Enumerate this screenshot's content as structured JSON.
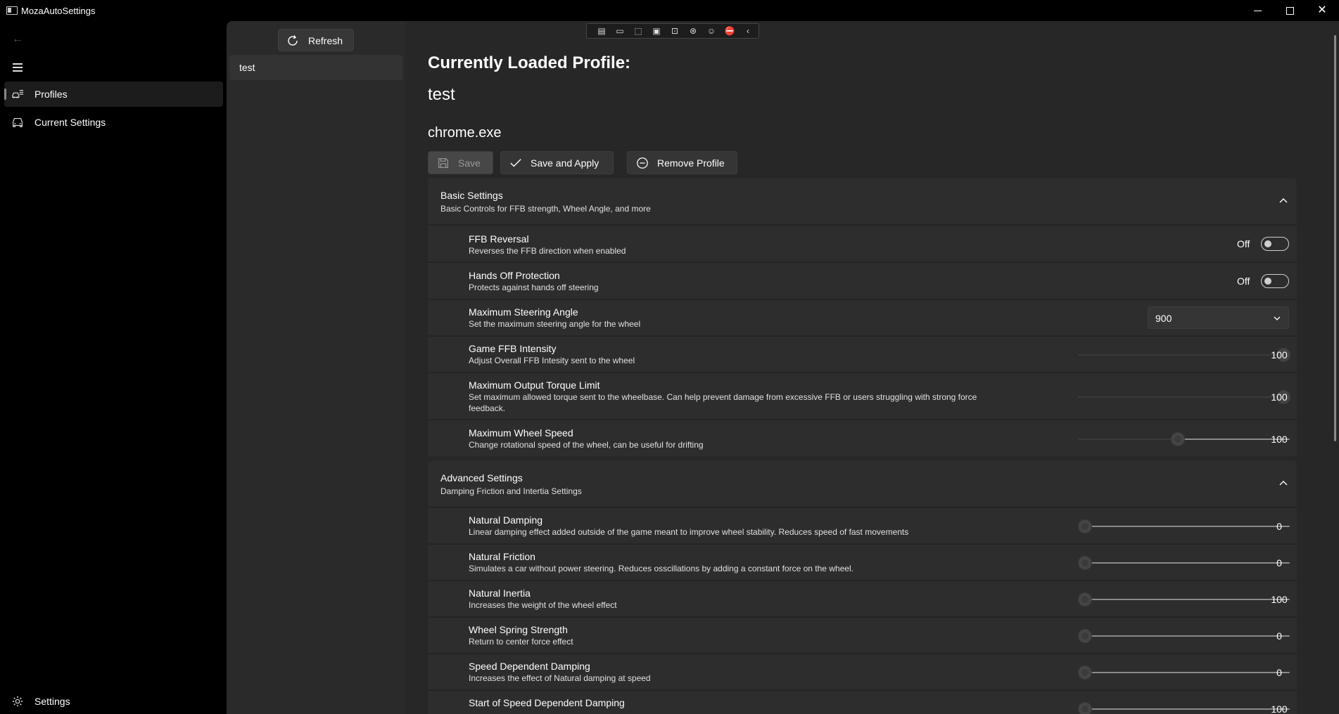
{
  "window": {
    "title": "MozaAutoSettings"
  },
  "nav": {
    "items": [
      {
        "label": "Profiles",
        "icon": "car-list-icon",
        "selected": true
      },
      {
        "label": "Current Settings",
        "icon": "car-icon",
        "selected": false
      }
    ],
    "footer": {
      "label": "Settings",
      "icon": "gear-icon"
    }
  },
  "profiles_panel": {
    "refresh_label": "Refresh",
    "items": [
      "test"
    ]
  },
  "main": {
    "heading": "Currently Loaded Profile:",
    "profile_name": "test",
    "executable": "chrome.exe",
    "buttons": {
      "save": "Save",
      "save_apply": "Save and Apply",
      "remove": "Remove Profile"
    },
    "basic": {
      "title": "Basic Settings",
      "subtitle": "Basic Controls for FFB strength, Wheel Angle, and more",
      "rows": [
        {
          "title": "FFB Reversal",
          "desc": "Reverses the FFB direction when enabled",
          "control": "toggle",
          "state": "Off"
        },
        {
          "title": "Hands Off Protection",
          "desc": "Protects against hands off steering",
          "control": "toggle",
          "state": "Off"
        },
        {
          "title": "Maximum Steering Angle",
          "desc": "Set the maximum steering angle for the wheel",
          "control": "dropdown",
          "value": "900"
        },
        {
          "title": "Game FFB Intensity",
          "desc": "Adjust Overall FFB Intesity sent to the wheel",
          "control": "slider",
          "value": "100",
          "fraction": 0.97
        },
        {
          "title": "Maximum Output Torque Limit",
          "desc": "Set maximum allowed torque sent to the wheelbase. Can help prevent damage from excessive FFB or users struggling with strong force feedback.",
          "control": "slider",
          "value": "100",
          "fraction": 0.97
        },
        {
          "title": "Maximum Wheel Speed",
          "desc": "Change rotational speed of the wheel, can be useful for drifting",
          "control": "slider",
          "value": "100",
          "fraction": 0.47
        }
      ]
    },
    "advanced": {
      "title": "Advanced Settings",
      "subtitle": "Damping Friction and Intertia Settings",
      "rows": [
        {
          "title": "Natural Damping",
          "desc": "Linear damping effect added outside of the game meant to improve wheel stability. Reduces speed of fast movements",
          "value": "0",
          "fraction": 0.03
        },
        {
          "title": "Natural Friction",
          "desc": "Simulates a car without power steering. Reduces osscillations by adding a constant force on the wheel.",
          "value": "0",
          "fraction": 0.03
        },
        {
          "title": "Natural Inertia",
          "desc": "Increases the weight of the wheel effect",
          "value": "100",
          "fraction": 0.03
        },
        {
          "title": "Wheel Spring Strength",
          "desc": "Return to center force effect",
          "value": "0",
          "fraction": 0.03
        },
        {
          "title": "Speed Dependent Damping",
          "desc": "Increases the effect of Natural damping at speed",
          "value": "0",
          "fraction": 0.03
        },
        {
          "title": "Start of Speed Dependent Damping",
          "desc": "",
          "value": "100",
          "fraction": 0.03
        }
      ]
    }
  }
}
